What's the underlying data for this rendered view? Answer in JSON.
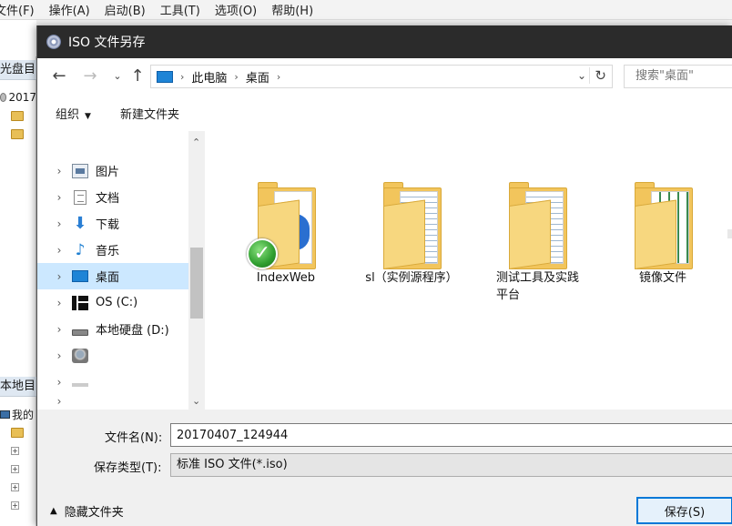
{
  "background_app": {
    "menu": [
      "文件(F)",
      "操作(A)",
      "启动(B)",
      "工具(T)",
      "选项(O)",
      "帮助(H)"
    ],
    "panel_top": "光盘目",
    "panel_bottom": "本地目",
    "tree_top": [
      "2017"
    ],
    "tree_bottom": [
      "我的"
    ]
  },
  "dialog": {
    "title": "ISO 文件另存",
    "address": {
      "crumbs": [
        "此电脑",
        "桌面"
      ],
      "search_placeholder": "搜索\"桌面\""
    },
    "commands": {
      "organize": "组织",
      "new_folder": "新建文件夹"
    },
    "nav_items": [
      {
        "label": "图片",
        "icon": "pictures-icon"
      },
      {
        "label": "文档",
        "icon": "documents-icon"
      },
      {
        "label": "下载",
        "icon": "download-icon"
      },
      {
        "label": "音乐",
        "icon": "music-icon"
      },
      {
        "label": "桌面",
        "icon": "desktop-icon",
        "selected": true
      },
      {
        "label": "OS (C:)",
        "icon": "os-drive-icon"
      },
      {
        "label": "本地硬盘 (D:)",
        "icon": "local-disk-icon"
      },
      {
        "label": "",
        "icon": "network-drive-icon"
      },
      {
        "label": "",
        "icon": "drive-icon"
      },
      {
        "label": "",
        "icon": ""
      }
    ],
    "files": [
      {
        "name": "IndexWeb",
        "badge": "sync-check-icon"
      },
      {
        "name": "sl（实例源程序）"
      },
      {
        "name": "测试工具及实践平台"
      },
      {
        "name": "镜像文件"
      }
    ],
    "filename_label": "文件名(N):",
    "filename_value": "20170407_124944",
    "filetype_label": "保存类型(T):",
    "filetype_value": "标准 ISO 文件(*.iso)",
    "hide_folders": "隐藏文件夹",
    "save_button": "保存(S)"
  }
}
